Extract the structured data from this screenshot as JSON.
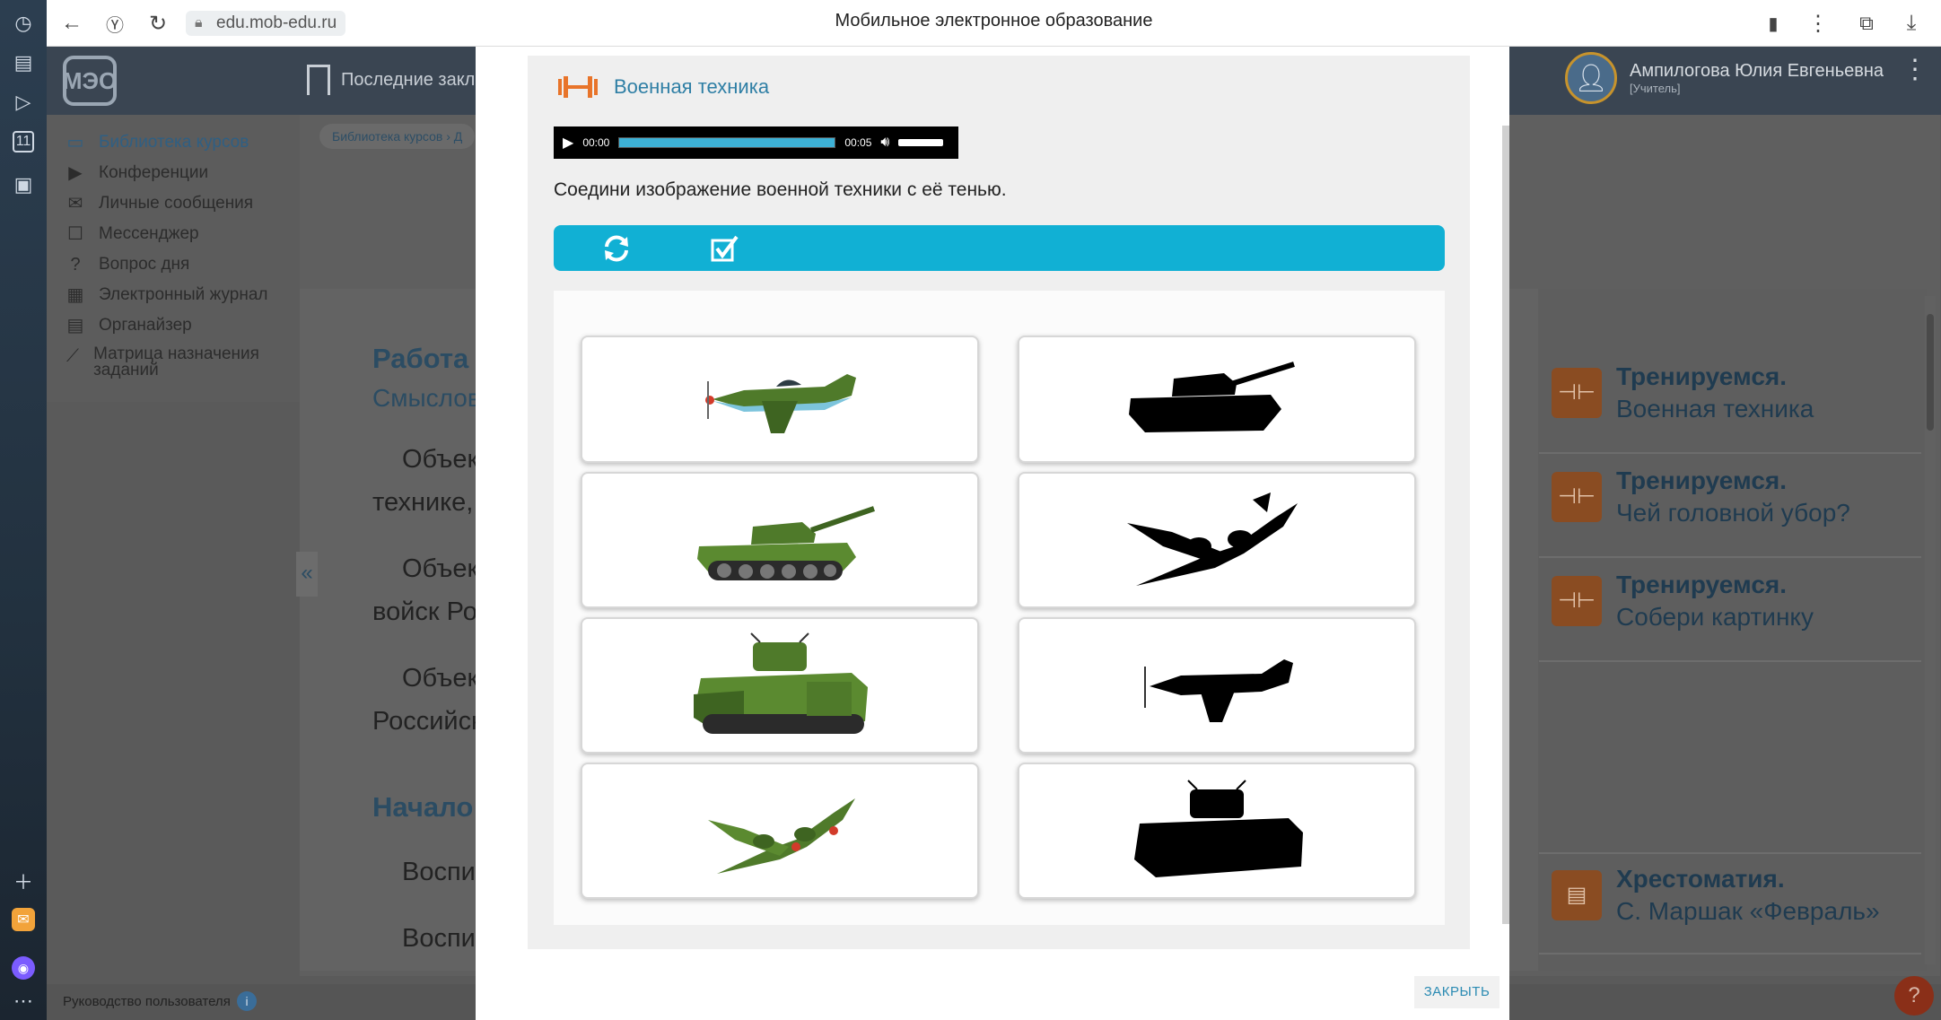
{
  "browser": {
    "url": "edu.mob-edu.ru",
    "page_title": "Мобильное электронное образование"
  },
  "app": {
    "logo_text": "МЭО",
    "bookmarks_label": "Последние закла",
    "user_name": "Ампилогова Юлия Евгеньевна",
    "user_role": "[Учитель]"
  },
  "nav": {
    "items": [
      {
        "label": "Библиотека курсов",
        "icon": "book-icon"
      },
      {
        "label": "Конференции",
        "icon": "video-icon"
      },
      {
        "label": "Личные сообщения",
        "icon": "mail-icon"
      },
      {
        "label": "Мессенджер",
        "icon": "chat-icon"
      },
      {
        "label": "Вопрос дня",
        "icon": "question-icon"
      },
      {
        "label": "Электронный журнал",
        "icon": "journal-icon"
      },
      {
        "label": "Органайзер",
        "icon": "calendar-icon"
      },
      {
        "label": "Матрица назначения заданий",
        "icon": "chart-icon"
      }
    ]
  },
  "breadcrumb": {
    "first": "Библиотека курсов",
    "second": "Д"
  },
  "background_page": {
    "heading1": "Работа с",
    "subheading1": "Смыслов",
    "p1_line1": "Объек",
    "p1_line2": "технике,",
    "p2_line1": "Объек",
    "p2_line2": "войск Ро",
    "p3_line1": "Объек",
    "p3_line2": "Российск",
    "heading2": "Начало",
    "p4": "Воспит",
    "p5": "Воспит"
  },
  "right_panel": {
    "cards": [
      {
        "title": "Тренируемся.",
        "subtitle": "Военная техника"
      },
      {
        "title": "Тренируемся.",
        "subtitle": "Чей головной убор?"
      },
      {
        "title": "Тренируемся.",
        "subtitle": "Собери картинку"
      },
      {
        "title": "Хрестоматия.",
        "subtitle": "С. Маршак «Февраль»"
      }
    ]
  },
  "footer": {
    "guide_label": "Руководство пользователя"
  },
  "modal": {
    "task_title": "Военная техника",
    "audio": {
      "current_time": "00:00",
      "duration": "00:05",
      "progress": 0
    },
    "instruction": "Соедини изображение военной техники с её тенью.",
    "close_label": "ЗАКРЫТЬ",
    "left_cards": [
      "fighter-plane",
      "t34-tank",
      "heavy-tank",
      "twin-engine-plane"
    ],
    "right_cards": [
      "tank-silhouette",
      "twin-engine-plane-silhouette",
      "fighter-plane-silhouette",
      "heavy-tank-silhouette"
    ]
  },
  "colors": {
    "accent": "#11b0d4",
    "task_orange": "#e8742a",
    "link_blue": "#2f7fa5",
    "vehicle_green": "#4f7a2a"
  }
}
